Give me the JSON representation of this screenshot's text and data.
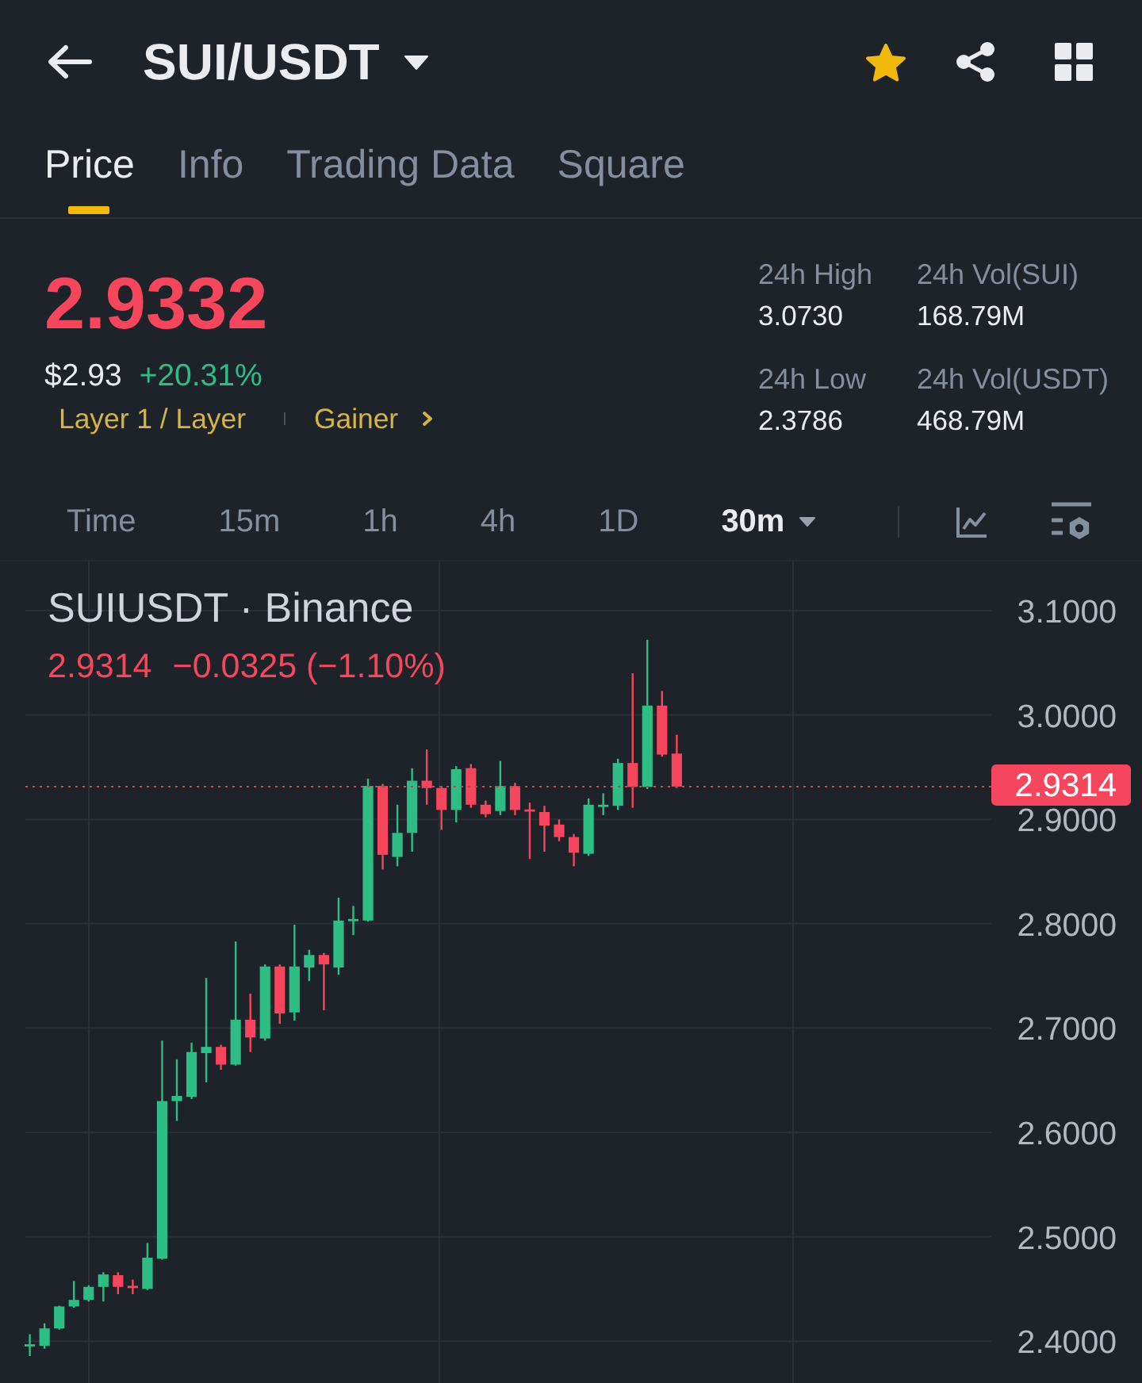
{
  "header": {
    "title": "SUI/USDT",
    "favorite": true
  },
  "tabs": [
    {
      "label": "Price",
      "selected": true
    },
    {
      "label": "Info",
      "selected": false
    },
    {
      "label": "Trading Data",
      "selected": false
    },
    {
      "label": "Square",
      "selected": false
    }
  ],
  "ticker": {
    "price": "2.9332",
    "price_rising": false,
    "usd_price": "$2.93",
    "change": "+20.31%",
    "change_rising": true,
    "tags": [
      {
        "label": "Layer 1 / Layer",
        "kind": "category"
      },
      {
        "label": "Gainer",
        "kind": "link"
      }
    ]
  },
  "stats": [
    {
      "label": "24h High",
      "value": "3.0730"
    },
    {
      "label": "24h Vol(SUI)",
      "value": "168.79M"
    },
    {
      "label": "24h Low",
      "value": "2.3786"
    },
    {
      "label": "24h Vol(USDT)",
      "value": "468.79M"
    }
  ],
  "intervals": [
    {
      "label": "Time",
      "selected": false,
      "dropdown": false
    },
    {
      "label": "15m",
      "selected": false,
      "dropdown": false
    },
    {
      "label": "1h",
      "selected": false,
      "dropdown": false
    },
    {
      "label": "4h",
      "selected": false,
      "dropdown": false
    },
    {
      "label": "1D",
      "selected": false,
      "dropdown": false
    },
    {
      "label": "30m",
      "selected": true,
      "dropdown": true
    }
  ],
  "chart": {
    "symbol": "SUIUSDT · Binance",
    "last": "2.9314",
    "change": "−0.0325 (−1.10%)",
    "rising": false,
    "price_tag": "2.9314",
    "y_axis": [
      "3.1000",
      "3.0000",
      "2.9000",
      "2.8000",
      "2.7000",
      "2.6000",
      "2.5000",
      "2.4000"
    ]
  }
}
